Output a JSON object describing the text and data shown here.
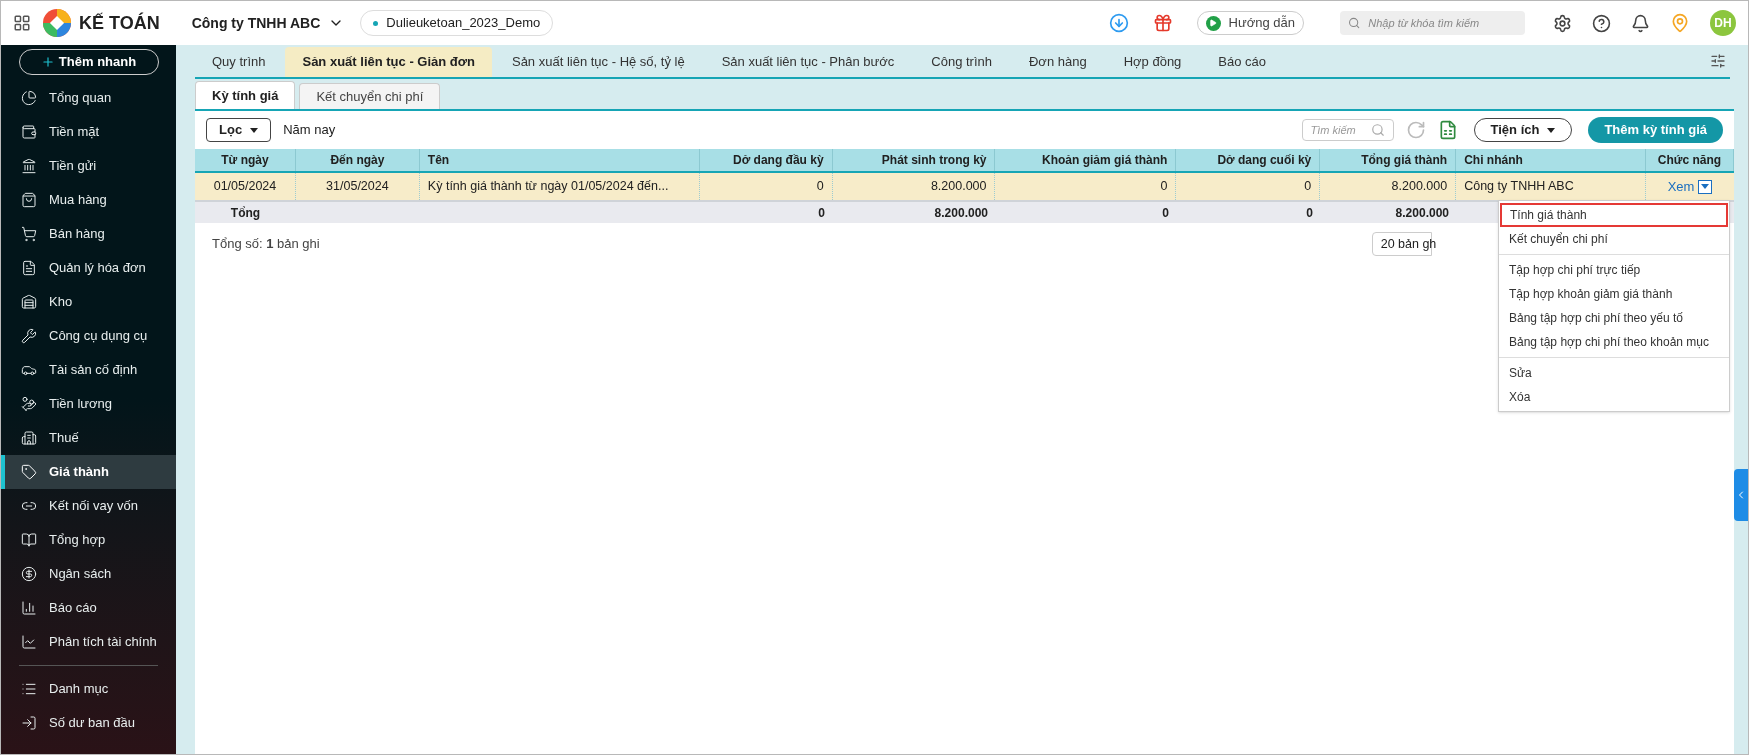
{
  "header": {
    "app_name": "KẾ TOÁN",
    "company": "Công ty TNHH ABC",
    "database": "Dulieuketoan_2023_Demo",
    "guide_button": "Hướng dẫn",
    "search": {
      "placeholder": "Nhập từ khóa tìm kiếm"
    },
    "avatar": "DH"
  },
  "sidebar": {
    "quick_add": "Thêm nhanh",
    "items": [
      {
        "label": "Tổng quan",
        "selected": false
      },
      {
        "label": "Tiền mặt",
        "selected": false
      },
      {
        "label": "Tiền gửi",
        "selected": false
      },
      {
        "label": "Mua hàng",
        "selected": false
      },
      {
        "label": "Bán hàng",
        "selected": false
      },
      {
        "label": "Quản lý hóa đơn",
        "selected": false
      },
      {
        "label": "Kho",
        "selected": false
      },
      {
        "label": "Công cụ dụng cụ",
        "selected": false
      },
      {
        "label": "Tài sản cố định",
        "selected": false
      },
      {
        "label": "Tiền lương",
        "selected": false
      },
      {
        "label": "Thuế",
        "selected": false
      },
      {
        "label": "Giá thành",
        "selected": true
      },
      {
        "label": "Kết nối vay vốn",
        "selected": false
      },
      {
        "label": "Tổng hợp",
        "selected": false
      },
      {
        "label": "Ngân sách",
        "selected": false
      },
      {
        "label": "Báo cáo",
        "selected": false
      },
      {
        "label": "Phân tích tài chính",
        "selected": false
      }
    ],
    "bottom_items": [
      {
        "label": "Danh mục",
        "selected": false
      },
      {
        "label": "Số dư ban đầu",
        "selected": false
      }
    ]
  },
  "tabs": [
    {
      "label": "Quy trình",
      "selected": false
    },
    {
      "label": "Sản xuất liên tục - Giản đơn",
      "selected": true
    },
    {
      "label": "Sản xuất liên tục - Hệ số, tỷ lệ",
      "selected": false
    },
    {
      "label": "Sản xuất liên tục - Phân bước",
      "selected": false
    },
    {
      "label": "Công trình",
      "selected": false
    },
    {
      "label": "Đơn hàng",
      "selected": false
    },
    {
      "label": "Hợp đồng",
      "selected": false
    },
    {
      "label": "Báo cáo",
      "selected": false
    }
  ],
  "sub_tabs": [
    {
      "label": "Kỳ tính giá",
      "selected": true
    },
    {
      "label": "Kết chuyển chi phí",
      "selected": false
    }
  ],
  "toolbar": {
    "filter_button": "Lọc",
    "filter_value": "Năm nay",
    "search": {
      "placeholder": "Tìm kiếm"
    },
    "utilities_button": "Tiện ích",
    "add_button": "Thêm kỳ tính giá"
  },
  "table": {
    "columns": [
      "Từ ngày",
      "Đến ngày",
      "Tên",
      "Dở dang đầu kỳ",
      "Phát sinh trong kỳ",
      "Khoản giảm giá thành",
      "Dở dang cuối kỳ",
      "Tổng giá thành",
      "Chi nhánh",
      "Chức năng"
    ],
    "rows": [
      {
        "selected": true,
        "cells": [
          "01/05/2024",
          "31/05/2024",
          "Kỳ tính giá thành từ ngày 01/05/2024 đến...",
          "0",
          "8.200.000",
          "0",
          "0",
          "8.200.000",
          "Công ty TNHH ABC"
        ],
        "action": "Xem"
      }
    ],
    "total_row": {
      "label": "Tổng",
      "values": [
        "0",
        "8.200.000",
        "0",
        "0",
        "8.200.000"
      ]
    }
  },
  "footer": {
    "record_count": "Tổng số: **1** bản ghi",
    "page_size": "20 bản gh"
  },
  "action_menu": {
    "groups": [
      [
        {
          "label": "Tính giá thành",
          "selected": true
        },
        {
          "label": "Kết chuyển chi phí",
          "selected": false
        }
      ],
      [
        {
          "label": "Tập hợp chi phí trực tiếp",
          "selected": false
        },
        {
          "label": "Tập hợp khoản giảm giá thành",
          "selected": false
        },
        {
          "label": "Bảng tập hợp chi phí theo yếu tố",
          "selected": false
        },
        {
          "label": "Bảng tập hợp chi phí theo khoản mục",
          "selected": false
        }
      ],
      [
        {
          "label": "Sửa",
          "selected": false
        },
        {
          "label": "Xóa",
          "selected": false
        }
      ]
    ]
  }
}
